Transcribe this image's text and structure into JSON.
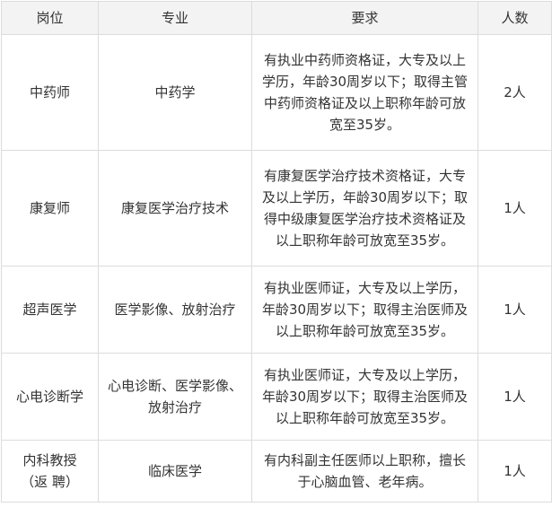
{
  "table": {
    "headers": [
      "岗位",
      "专业",
      "要求",
      "人数"
    ],
    "rows": [
      {
        "position": [
          "中药师"
        ],
        "major": [
          "中药学"
        ],
        "requirement": [
          "有执业中药师资格证，大专及以上",
          "学历，年龄30周岁以下；取得主管",
          "中药师资格证及以上职称年龄可放",
          "宽至35岁。"
        ],
        "count": "2人"
      },
      {
        "position": [
          "康复师"
        ],
        "major": [
          "康复医学治疗技术"
        ],
        "requirement": [
          "有康复医学治疗技术资格证，大专",
          "及以上学历，年龄30周岁以下；取",
          "得中级康复医学治疗技术资格证及",
          "以上职称年龄可放宽至35岁。"
        ],
        "count": "1人"
      },
      {
        "position": [
          "超声医学"
        ],
        "major": [
          "医学影像、放射治疗"
        ],
        "requirement": [
          "有执业医师证，大专及以上学历，",
          "年龄30周岁以下；取得主治医师及",
          "以上职称年龄可放宽至35岁。"
        ],
        "count": "1人"
      },
      {
        "position": [
          "心电诊断学"
        ],
        "major": [
          "心电诊断、医学影像、",
          "放射治疗"
        ],
        "requirement": [
          "有执业医师证，大专及以上学历，",
          "年龄30周岁以下；取得主治医师及",
          "以上职称年龄可放宽至35岁。"
        ],
        "count": "1人"
      },
      {
        "position": [
          "内科教授",
          "（返 聘）"
        ],
        "major": [
          "临床医学"
        ],
        "requirement": [
          "有内科副主任医师以上职称，擅长",
          "于心脑血管、老年病。"
        ],
        "count": "1人"
      }
    ]
  }
}
